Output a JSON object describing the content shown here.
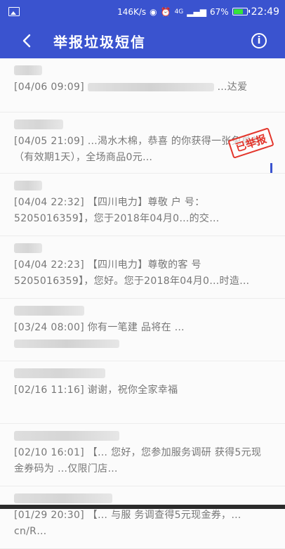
{
  "status": {
    "net_speed": "146K/s",
    "network": "4G",
    "battery_pct": "67%",
    "time": "22:49"
  },
  "toolbar": {
    "title": "举报垃圾短信",
    "info_label": "i"
  },
  "messages": [
    {
      "date": "[04/06 09:09]",
      "text": "…达爱"
    },
    {
      "date": "[04/05 21:09]",
      "text": "…渴水木棉，恭喜 的你获得一张免单券（有效期1天），全场商品0元…",
      "stamp": "已举报"
    },
    {
      "date": "[04/04 22:32]",
      "text": "【四川电力】尊敬 户 号：5205016359】，您于2018年04月0…的交…"
    },
    {
      "date": "[04/04 22:23]",
      "text": "【四川电力】尊敬的客 号 5205016359】，您好。您于2018年04月0…时造…"
    },
    {
      "date": "[03/24 08:00]",
      "text": "你有一笔建 品将在 …"
    },
    {
      "date": "[02/16 11:16]",
      "text": "谢谢，祝你全家幸福"
    },
    {
      "date": "[02/10 16:01]",
      "text": "【… 您好，您参加服务调研 获得5元现金券码为 …仅限门店…"
    },
    {
      "date": "[01/29 20:30]",
      "text": "【… 与服 务调查得5元现金券，… cn/R…"
    }
  ]
}
